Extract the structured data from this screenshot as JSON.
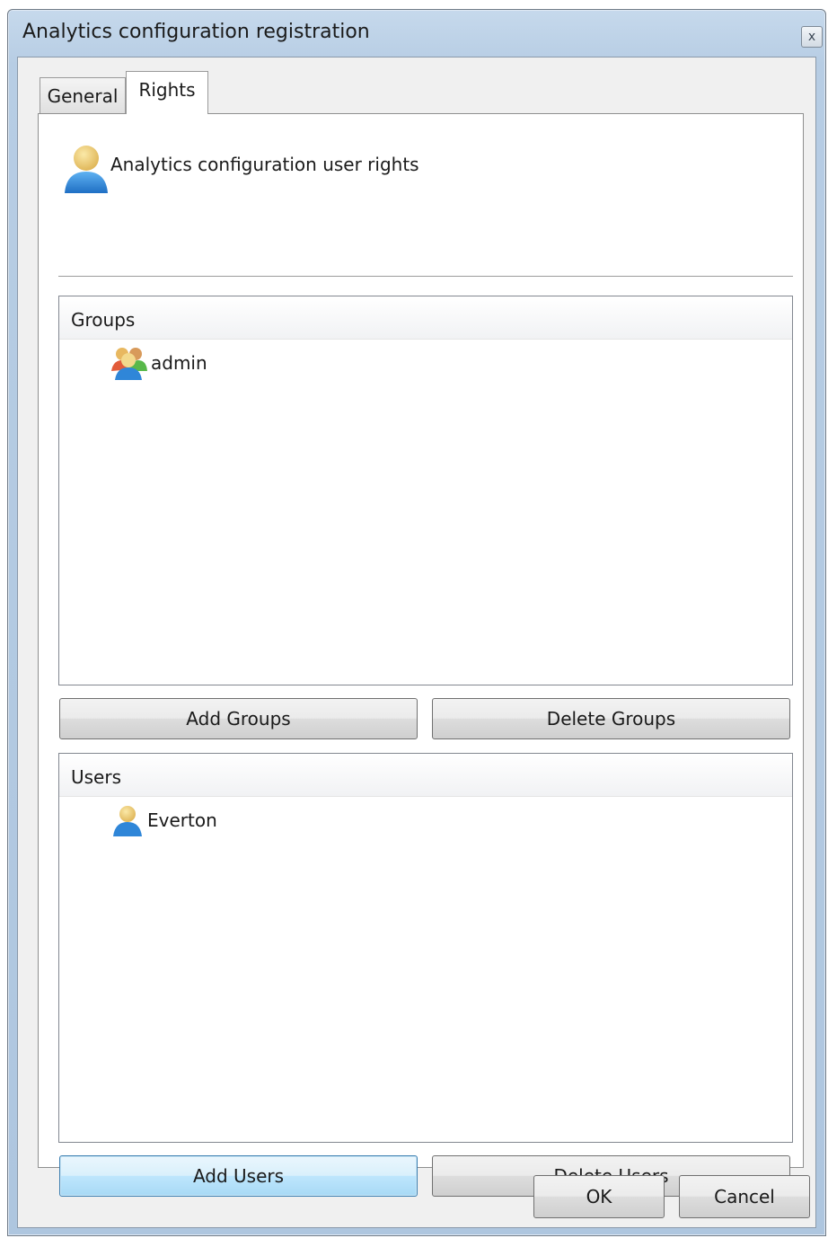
{
  "window": {
    "title": "Analytics configuration registration",
    "close_glyph": "x"
  },
  "tabs": [
    {
      "label": "General",
      "selected": false
    },
    {
      "label": "Rights",
      "selected": true
    }
  ],
  "rights": {
    "header_icon": "user-icon",
    "header_label": "Analytics configuration user rights",
    "groups": {
      "header": "Groups",
      "items": [
        {
          "label": "admin",
          "icon": "group-icon"
        }
      ],
      "add_button": "Add Groups",
      "delete_button": "Delete Groups"
    },
    "users": {
      "header": "Users",
      "items": [
        {
          "label": "Everton",
          "icon": "user-icon"
        }
      ],
      "add_button": "Add Users",
      "delete_button": "Delete Users"
    }
  },
  "footer": {
    "ok_label": "OK",
    "cancel_label": "Cancel"
  }
}
